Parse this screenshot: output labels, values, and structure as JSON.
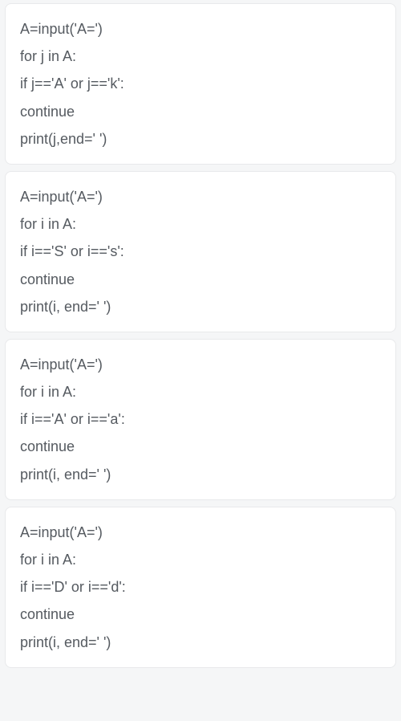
{
  "blocks": [
    {
      "lines": [
        "A=input('A=')",
        "for j in A:",
        "if j=='A' or j=='k':",
        "continue",
        "print(j,end=' ')"
      ]
    },
    {
      "lines": [
        "A=input('A=')",
        "for i in A:",
        "if i=='S' or i=='s':",
        "continue",
        "print(i, end=' ')"
      ]
    },
    {
      "lines": [
        "A=input('A=')",
        "for i in A:",
        "if i=='A' or i=='a':",
        "continue",
        "print(i, end=' ')"
      ]
    },
    {
      "lines": [
        "A=input('A=')",
        "for i in A:",
        "if i=='D' or i=='d':",
        "continue",
        "print(i, end=' ')"
      ]
    }
  ]
}
